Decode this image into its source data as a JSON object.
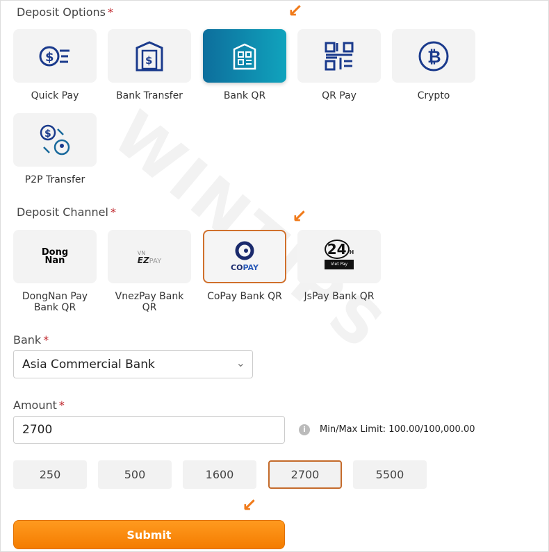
{
  "watermark": "WINTIPS",
  "deposit_options": {
    "label": "Deposit Options",
    "required": "*",
    "items": [
      {
        "label": "Quick Pay",
        "icon": "quick-pay-icon"
      },
      {
        "label": "Bank Transfer",
        "icon": "bank-transfer-icon"
      },
      {
        "label": "Bank QR",
        "icon": "bank-qr-icon",
        "selected": true
      },
      {
        "label": "QR Pay",
        "icon": "qr-code-icon"
      },
      {
        "label": "Crypto",
        "icon": "bitcoin-icon"
      },
      {
        "label": "P2P Transfer",
        "icon": "p2p-transfer-icon"
      }
    ]
  },
  "deposit_channel": {
    "label": "Deposit Channel",
    "required": "*",
    "items": [
      {
        "label": "DongNan Pay Bank QR",
        "logo": "DongNan"
      },
      {
        "label": "VnezPay Bank QR",
        "logo": "VN EZPAY"
      },
      {
        "label": "CoPay Bank QR",
        "logo": "COPAY",
        "selected": true
      },
      {
        "label": "JsPay Bank QR",
        "logo": "24H VietPay"
      }
    ]
  },
  "bank": {
    "label": "Bank",
    "required": "*",
    "value": "Asia Commercial Bank"
  },
  "amount": {
    "label": "Amount",
    "required": "*",
    "value": "2700",
    "limit": "Min/Max Limit: 100.00/100,000.00",
    "presets": [
      "250",
      "500",
      "1600",
      "2700",
      "5500"
    ],
    "selected": "2700"
  },
  "submit_label": "Submit",
  "colors": {
    "accent": "#f47c00",
    "selected_tile": "#0d6e9c",
    "icon": "#1a3a8c"
  }
}
